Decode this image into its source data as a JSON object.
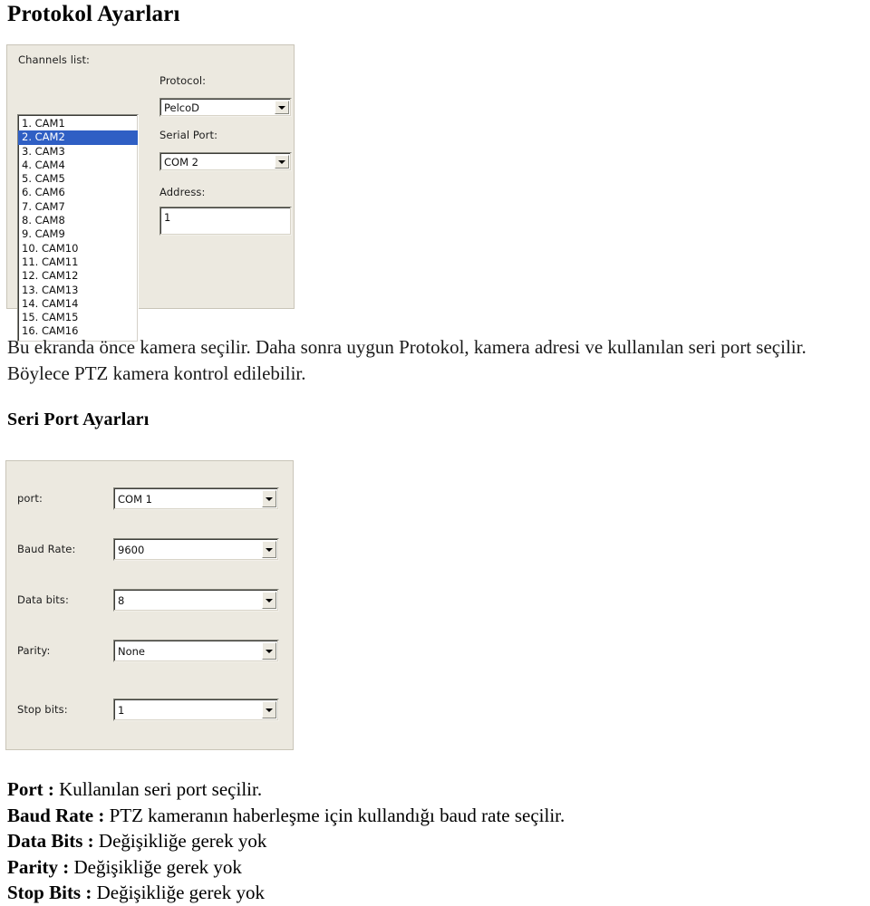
{
  "document": {
    "headings": {
      "protocol_settings": "Protokol Ayarları",
      "serial_port_settings": "Seri Port Ayarları"
    },
    "paragraphs": {
      "protocol_description": "Bu ekranda önce kamera seçilir. Daha sonra uygun Protokol, kamera adresi ve kullanılan seri port seçilir. Böylece PTZ kamera kontrol edilebilir."
    },
    "serial_descriptions": [
      {
        "term": "Port :",
        "text": "Kullanılan seri port seçilir."
      },
      {
        "term": "Baud Rate :",
        "text": "PTZ kameranın haberleşme için kullandığı baud rate seçilir."
      },
      {
        "term": "Data Bits :",
        "text": "Değişikliğe gerek yok"
      },
      {
        "term": "Parity :",
        "text": "Değişikliğe gerek yok"
      },
      {
        "term": "Stop Bits :",
        "text": "Değişikliğe gerek yok"
      }
    ]
  },
  "protocol_dialog": {
    "channels_label": "Channels list:",
    "channels": [
      {
        "label": "1. CAM1",
        "selected": false
      },
      {
        "label": "2. CAM2",
        "selected": true
      },
      {
        "label": "3. CAM3",
        "selected": false
      },
      {
        "label": "4. CAM4",
        "selected": false
      },
      {
        "label": "5. CAM5",
        "selected": false
      },
      {
        "label": "6. CAM6",
        "selected": false
      },
      {
        "label": "7. CAM7",
        "selected": false
      },
      {
        "label": "8. CAM8",
        "selected": false
      },
      {
        "label": "9. CAM9",
        "selected": false
      },
      {
        "label": "10. CAM10",
        "selected": false
      },
      {
        "label": "11. CAM11",
        "selected": false
      },
      {
        "label": "12. CAM12",
        "selected": false
      },
      {
        "label": "13. CAM13",
        "selected": false
      },
      {
        "label": "14. CAM14",
        "selected": false
      },
      {
        "label": "15. CAM15",
        "selected": false
      },
      {
        "label": "16. CAM16",
        "selected": false
      }
    ],
    "protocol_label": "Protocol:",
    "protocol_value": "PelcoD",
    "serial_port_label": "Serial Port:",
    "serial_port_value": "COM 2",
    "address_label": "Address:",
    "address_value": "1"
  },
  "serial_dialog": {
    "rows": [
      {
        "label": "port:",
        "value": "COM 1"
      },
      {
        "label": "Baud Rate:",
        "value": "9600"
      },
      {
        "label": "Data bits:",
        "value": "8"
      },
      {
        "label": "Parity:",
        "value": "None"
      },
      {
        "label": "Stop bits:",
        "value": "1"
      }
    ]
  },
  "colors": {
    "page_background": "#ffffff",
    "dialog_background": "#ece9e0",
    "selection_blue": "#2f5fc4",
    "field_white": "#ffffff",
    "text": "#101010"
  }
}
